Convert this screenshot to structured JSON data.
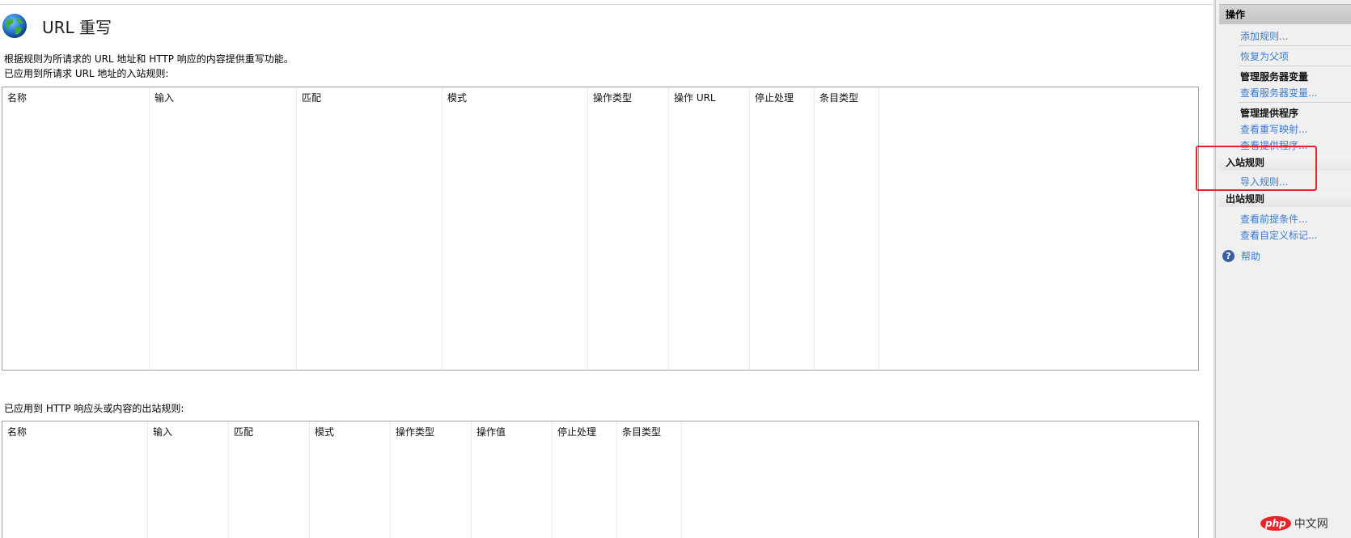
{
  "header": {
    "title": "URL 重写",
    "description": "根据规则为所请求的 URL 地址和 HTTP 响应的内容提供重写功能。"
  },
  "inbound": {
    "label": "已应用到所请求 URL 地址的入站规则:",
    "columns": [
      "名称",
      "输入",
      "匹配",
      "模式",
      "操作类型",
      "操作 URL",
      "停止处理",
      "条目类型"
    ]
  },
  "outbound": {
    "label": "已应用到 HTTP 响应头或内容的出站规则:",
    "columns": [
      "名称",
      "输入",
      "匹配",
      "模式",
      "操作类型",
      "操作值",
      "停止处理",
      "条目类型"
    ]
  },
  "actions": {
    "title": "操作",
    "add_rule": "添加规则...",
    "revert_parent": "恢复为父项",
    "manage_server_vars": "管理服务器变量",
    "view_server_vars": "查看服务器变量...",
    "manage_providers": "管理提供程序",
    "view_rewrite_maps": "查看重写映射...",
    "view_providers": "查看提供程序...",
    "inbound_rules": "入站规则",
    "import_rules": "导入规则...",
    "outbound_rules": "出站规则",
    "view_preconditions": "查看前提条件...",
    "view_custom_tags": "查看自定义标记...",
    "help": "帮助"
  },
  "watermark": {
    "badge": "php",
    "text": "中文网"
  },
  "colors": {
    "link": "#3b7ad0",
    "highlight": "#e8242a"
  }
}
